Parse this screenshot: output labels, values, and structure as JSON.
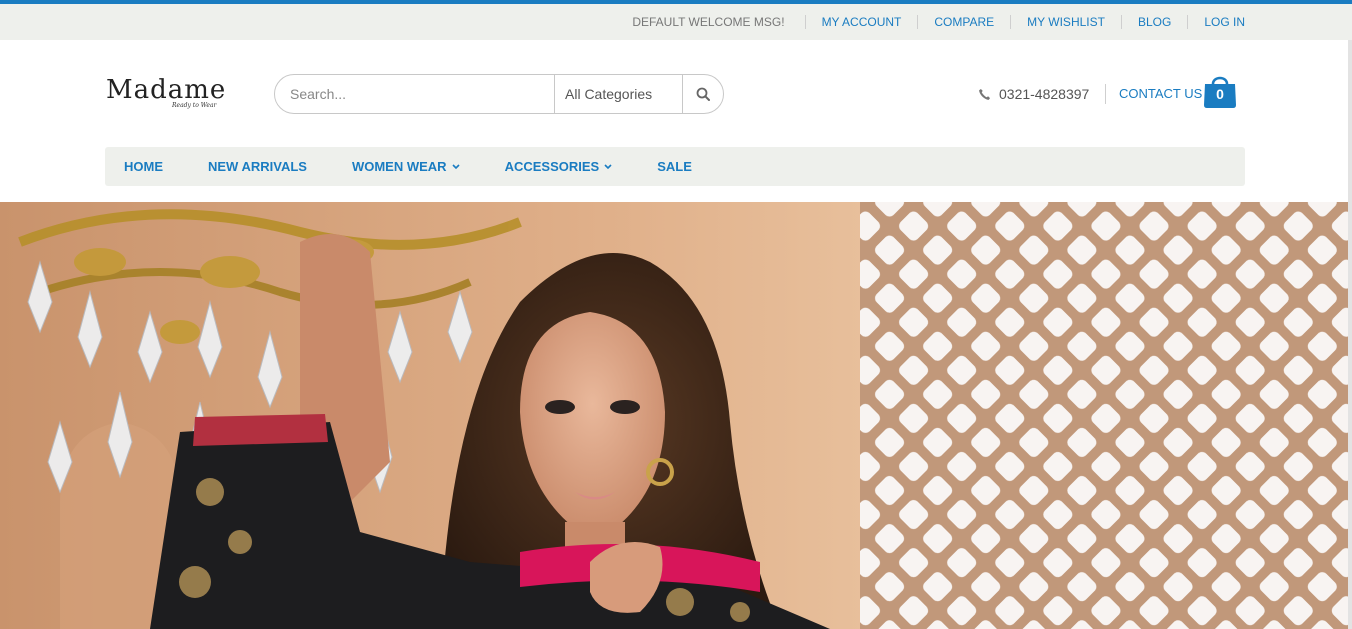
{
  "top_bar": {
    "welcome": "DEFAULT WELCOME MSG!",
    "links": [
      "MY ACCOUNT",
      "COMPARE",
      "MY WISHLIST",
      "BLOG",
      "LOG IN"
    ]
  },
  "header": {
    "logo_text": "Madame",
    "logo_tagline": "Ready to Wear",
    "search_placeholder": "Search...",
    "category_select": "All Categories",
    "phone": "0321-4828397",
    "contact_label": "CONTACT US",
    "cart_count": "0"
  },
  "nav": {
    "items": [
      {
        "label": "HOME",
        "has_dropdown": false
      },
      {
        "label": "NEW ARRIVALS",
        "has_dropdown": false
      },
      {
        "label": "WOMEN WEAR",
        "has_dropdown": true
      },
      {
        "label": "ACCESSORIES",
        "has_dropdown": true
      },
      {
        "label": "SALE",
        "has_dropdown": false
      }
    ]
  },
  "colors": {
    "accent": "#1a7cc1",
    "bar_background": "#eef0ec"
  },
  "icons": [
    "search-icon",
    "phone-icon",
    "shopping-bag-icon",
    "chevron-down-icon"
  ]
}
